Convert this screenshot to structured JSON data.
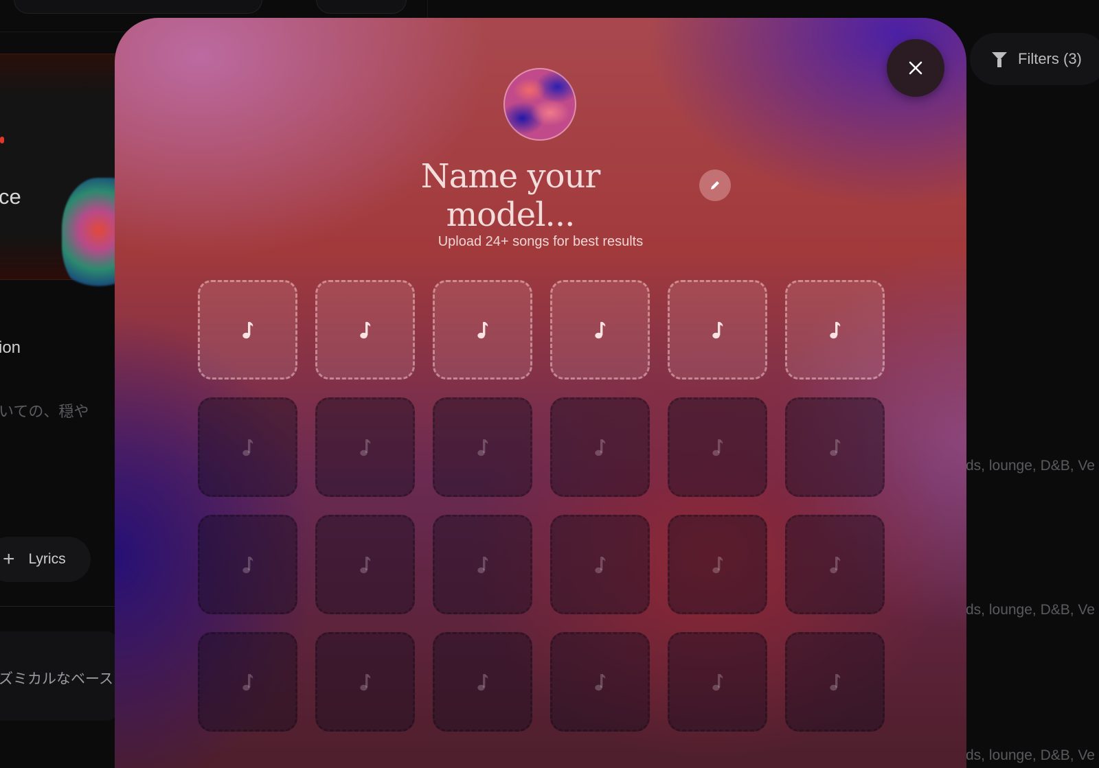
{
  "background": {
    "card_title": "ce",
    "section_label": "ion",
    "jp_text_1": "いての、穏や",
    "lyrics_button_label": "Lyrics",
    "jp_text_2": "ズミカルなベース",
    "filters_label": "Filters (3)",
    "tags": [
      "ds, lounge, D&B, Ve",
      "ds, lounge, D&B, Ve",
      "ds, lounge, D&B, Ve"
    ]
  },
  "modal": {
    "name_placeholder": "Name your model...",
    "subtitle": "Upload 24+ songs for best results",
    "slots": {
      "count": 24,
      "columns": 6,
      "active_count": 6,
      "icon": "music-note-icon"
    },
    "icons": {
      "close": "close-icon",
      "edit": "pencil-icon"
    }
  }
}
